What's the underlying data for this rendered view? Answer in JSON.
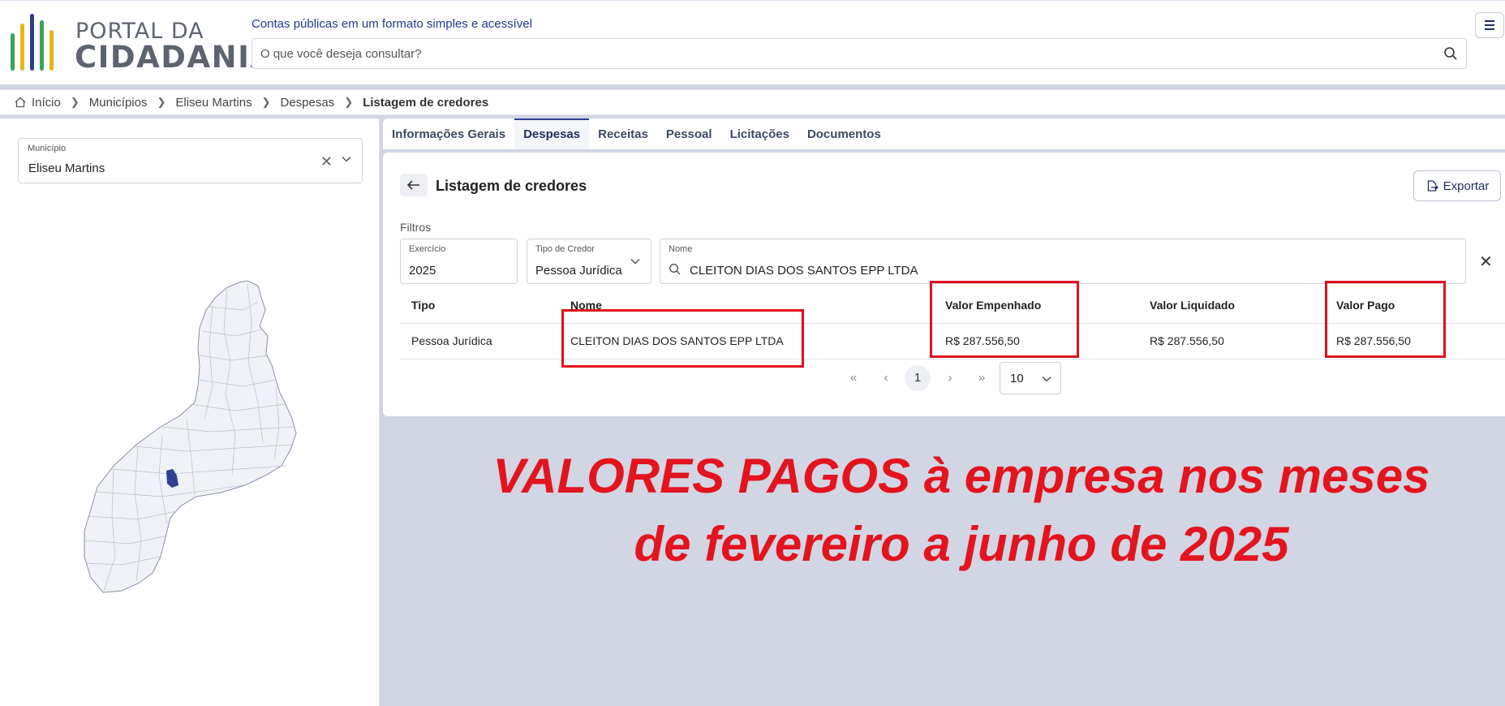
{
  "header": {
    "logo_line1": "PORTAL DA",
    "logo_line2": "CIDADANIA",
    "logo_colors": [
      "#3aa35a",
      "#e6b51c",
      "#2e3f8f",
      "#3aa35a",
      "#e6b51c"
    ],
    "tagline": "Contas públicas em um formato simples e acessível",
    "search_placeholder": "O que você deseja consultar?"
  },
  "breadcrumb": {
    "items": [
      "Início",
      "Municípios",
      "Eliseu Martins",
      "Despesas",
      "Listagem de credores"
    ]
  },
  "sidebar": {
    "municipio_label": "Município",
    "municipio_value": "Eliseu Martins"
  },
  "tabs": [
    "Informações Gerais",
    "Despesas",
    "Receitas",
    "Pessoal",
    "Licitações",
    "Documentos"
  ],
  "active_tab": "Despesas",
  "panel": {
    "title": "Listagem de credores",
    "export_label": "Exportar",
    "filters_label": "Filtros",
    "exercicio_label": "Exercício",
    "exercicio_value": "2025",
    "tipo_label": "Tipo de Credor",
    "tipo_value": "Pessoa Jurídica",
    "nome_label": "Nome",
    "nome_value": "CLEITON DIAS DOS SANTOS EPP LTDA"
  },
  "table": {
    "headers": [
      "Tipo",
      "Nome",
      "Valor Empenhado",
      "Valor Liquidado",
      "Valor Pago"
    ],
    "rows": [
      [
        "Pessoa Jurídica",
        "CLEITON DIAS DOS SANTOS EPP LTDA",
        "R$ 287.556,50",
        "R$ 287.556,50",
        "R$ 287.556,50"
      ]
    ]
  },
  "pagination": {
    "current_page": "1",
    "page_size": "10"
  },
  "annotation": {
    "line1": "VALORES PAGOS à empresa nos meses",
    "line2": "de fevereiro a junho de 2025",
    "color": "#e3141e"
  }
}
